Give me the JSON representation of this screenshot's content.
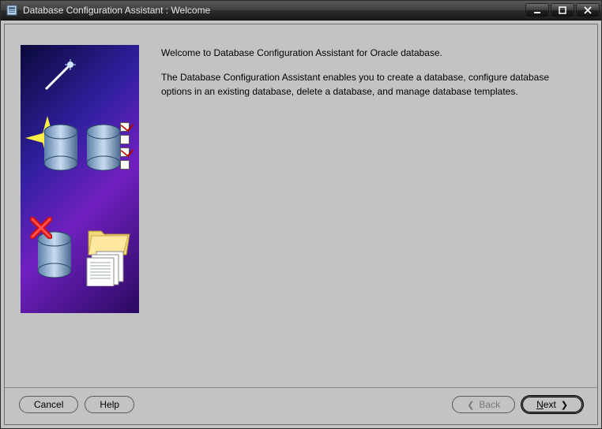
{
  "window": {
    "title": "Database Configuration Assistant : Welcome"
  },
  "content": {
    "welcome_line": "Welcome to Database Configuration Assistant for Oracle database.",
    "description": "The Database Configuration Assistant enables you to create a database, configure database options in an existing database, delete a database, and manage database templates."
  },
  "buttons": {
    "cancel": "Cancel",
    "help": "Help",
    "back": "Back",
    "next": "Next"
  }
}
